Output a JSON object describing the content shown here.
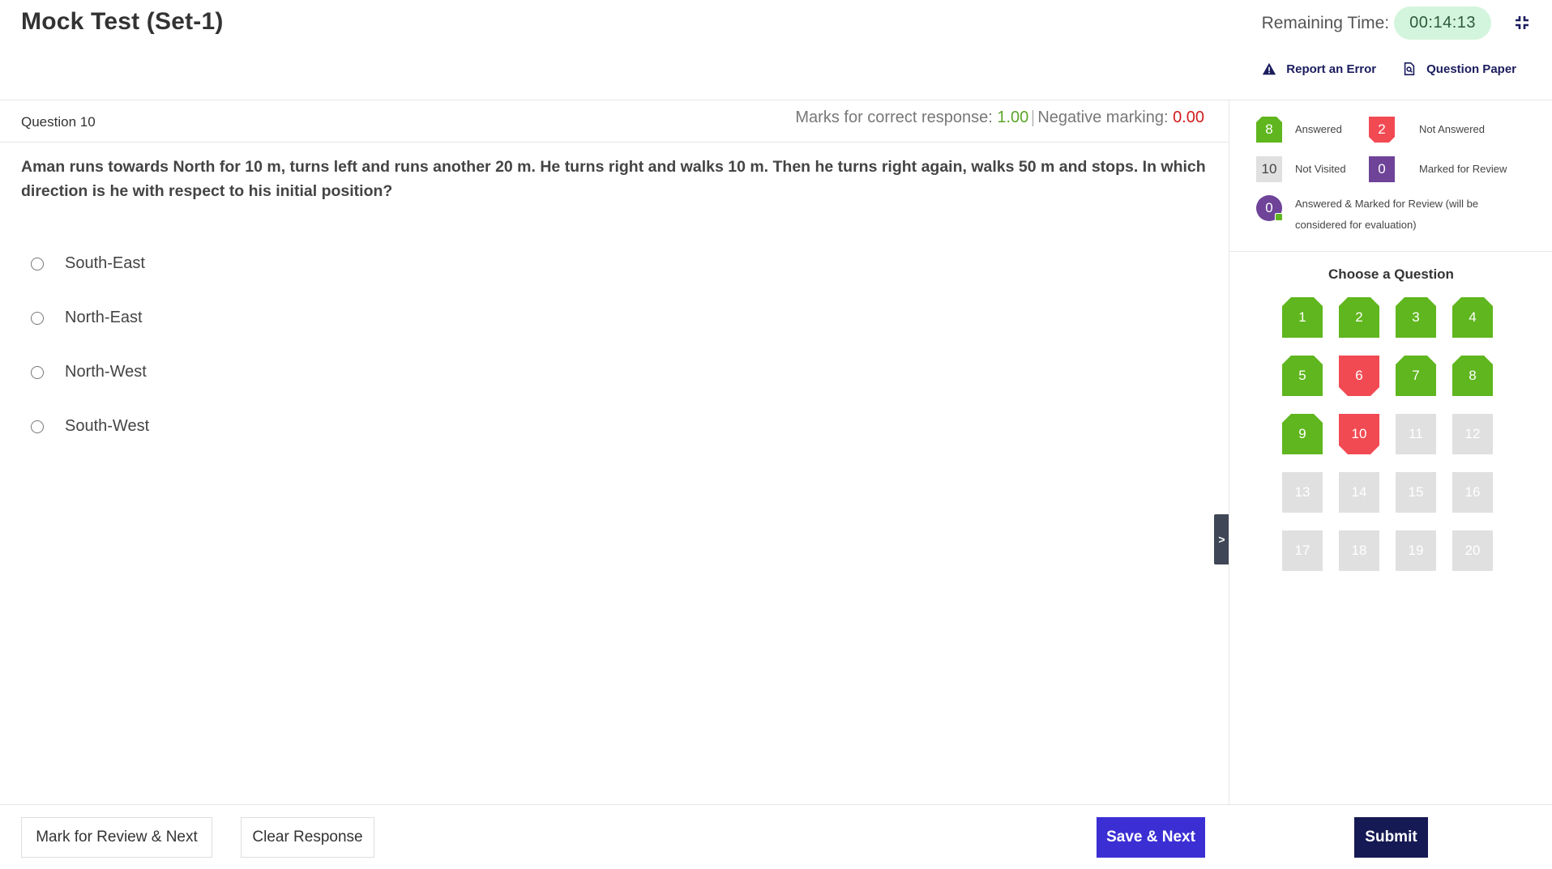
{
  "header": {
    "title": "Mock Test (Set-1)",
    "timer_label": "Remaining Time:",
    "timer_value": "00:14:13",
    "report_label": "Report an Error",
    "paper_label": "Question Paper"
  },
  "question": {
    "number_label": "Question 10",
    "marks_label": "Marks for correct response:",
    "marks_value": "1.00",
    "negative_label": "Negative marking:",
    "negative_value": "0.00",
    "text": "Aman runs towards North for 10 m, turns left and runs another 20 m. He turns right and walks 10 m. Then he turns right again, walks 50 m and stops. In which direction is he with respect to his initial position?",
    "options": [
      "South-East",
      "North-East",
      "North-West",
      "South-West"
    ]
  },
  "toggle_label": ">",
  "footer": {
    "review_next": "Mark for Review & Next",
    "clear": "Clear Response",
    "save_next": "Save & Next",
    "submit": "Submit"
  },
  "legend": {
    "answered_count": "8",
    "answered_label": "Answered",
    "not_answered_count": "2",
    "not_answered_label": "Not Answered",
    "not_visited_count": "10",
    "not_visited_label": "Not Visited",
    "marked_count": "0",
    "marked_label": "Marked for Review",
    "answered_marked_count": "0",
    "answered_marked_label_1": "Answered & Marked for Review (will be",
    "answered_marked_label_2": "considered for evaluation)"
  },
  "palette": {
    "title": "Choose a Question",
    "questions": [
      {
        "n": "1",
        "status": "answered"
      },
      {
        "n": "2",
        "status": "answered"
      },
      {
        "n": "3",
        "status": "answered"
      },
      {
        "n": "4",
        "status": "answered"
      },
      {
        "n": "5",
        "status": "answered"
      },
      {
        "n": "6",
        "status": "not-answered"
      },
      {
        "n": "7",
        "status": "answered"
      },
      {
        "n": "8",
        "status": "answered"
      },
      {
        "n": "9",
        "status": "answered"
      },
      {
        "n": "10",
        "status": "not-answered"
      },
      {
        "n": "11",
        "status": "not-visited"
      },
      {
        "n": "12",
        "status": "not-visited"
      },
      {
        "n": "13",
        "status": "not-visited"
      },
      {
        "n": "14",
        "status": "not-visited"
      },
      {
        "n": "15",
        "status": "not-visited"
      },
      {
        "n": "16",
        "status": "not-visited"
      },
      {
        "n": "17",
        "status": "not-visited"
      },
      {
        "n": "18",
        "status": "not-visited"
      },
      {
        "n": "19",
        "status": "not-visited"
      },
      {
        "n": "20",
        "status": "not-visited"
      }
    ]
  },
  "colors": {
    "answered": "#5fb61e",
    "not_answered": "#f24a53",
    "not_visited": "#e0e0e0",
    "marked": "#6e4398",
    "primary": "#3b2fd4",
    "submit": "#151a54"
  }
}
